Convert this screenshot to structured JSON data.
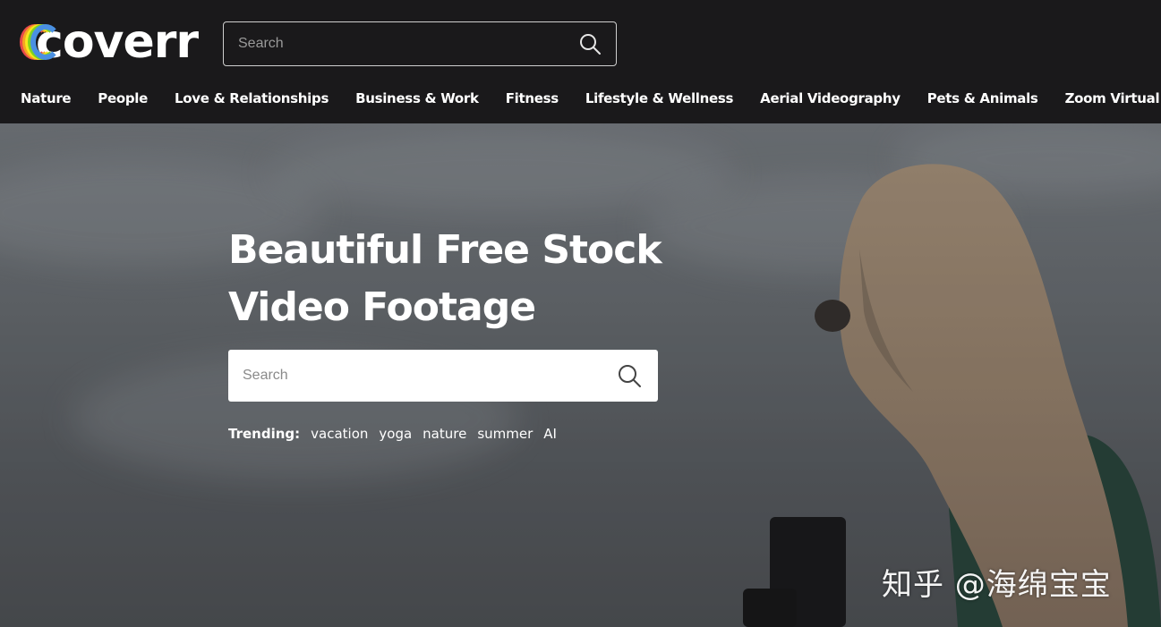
{
  "header": {
    "logo_text": "coverr",
    "logo_colors": [
      "#e84a4a",
      "#f5a623",
      "#f8e71c",
      "#4a90e2",
      "#7ed321"
    ],
    "search_placeholder": "Search",
    "search_icon": "search-icon"
  },
  "nav": {
    "items": [
      {
        "label": "Nature"
      },
      {
        "label": "People"
      },
      {
        "label": "Love & Relationships"
      },
      {
        "label": "Business & Work"
      },
      {
        "label": "Fitness"
      },
      {
        "label": "Lifestyle & Wellness"
      },
      {
        "label": "Aerial Videography"
      },
      {
        "label": "Pets & Animals"
      },
      {
        "label": "Zoom Virtual Backgrounds"
      }
    ]
  },
  "hero": {
    "title_line1": "Beautiful Free Stock",
    "title_line2": "Video Footage",
    "search_placeholder": "Search",
    "trending_label": "Trending:",
    "trending_items": [
      "vacation",
      "yoga",
      "nature",
      "summer",
      "AI"
    ]
  },
  "watermark": {
    "text": "知乎 @海绵宝宝"
  },
  "colors": {
    "header_bg": "#1a191b",
    "hero_text": "#ffffff",
    "search_bg": "#ffffff"
  }
}
